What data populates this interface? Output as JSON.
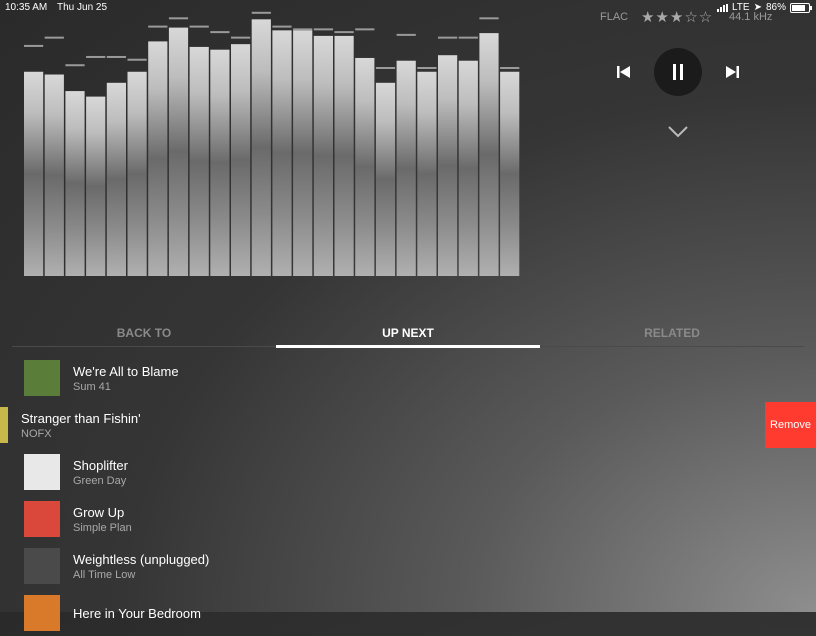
{
  "status": {
    "time": "10:35 AM",
    "date": "Thu Jun 25",
    "network": "LTE",
    "battery": "86%"
  },
  "now_playing": {
    "format": "FLAC",
    "rating_stars": "★★★☆☆",
    "rating": 3,
    "sample_rate": "44.1 kHz"
  },
  "controls": {
    "previous_icon": "skip-back-icon",
    "pause_icon": "pause-icon",
    "next_icon": "skip-forward-icon",
    "collapse_icon": "chevron-down-icon"
  },
  "tabs": [
    {
      "label": "BACK TO",
      "active": false
    },
    {
      "label": "UP NEXT",
      "active": true
    },
    {
      "label": "RELATED",
      "active": false
    }
  ],
  "queue": [
    {
      "title": "We're All to Blame",
      "artist": "Sum 41",
      "thumb_color": "#5a7d3a"
    },
    {
      "title": "Stranger than Fishin'",
      "artist": "NOFX",
      "thumb_color": "#c8b84a"
    },
    {
      "title": "Shoplifter",
      "artist": "Green Day",
      "thumb_color": "#e8e8e8"
    },
    {
      "title": "Grow Up",
      "artist": "Simple Plan",
      "thumb_color": "#d9483b"
    },
    {
      "title": "Weightless (unplugged)",
      "artist": "All Time Low",
      "thumb_color": "#4a4a4a"
    },
    {
      "title": "Here in Your Bedroom",
      "artist": "",
      "thumb_color": "#d97a2a"
    }
  ],
  "swipe_action": {
    "label": "Remove",
    "color": "#ff3b30"
  },
  "visualizer": {
    "levels": [
      0.74,
      0.73,
      0.67,
      0.65,
      0.7,
      0.74,
      0.85,
      0.9,
      0.83,
      0.82,
      0.84,
      0.93,
      0.89,
      0.89,
      0.87,
      0.87,
      0.79,
      0.7,
      0.78,
      0.74,
      0.8,
      0.78,
      0.88,
      0.74
    ],
    "peaks": [
      0.83,
      0.86,
      0.76,
      0.79,
      0.79,
      0.78,
      0.9,
      0.93,
      0.9,
      0.88,
      0.86,
      0.95,
      0.9,
      0.89,
      0.89,
      0.88,
      0.89,
      0.75,
      0.87,
      0.75,
      0.86,
      0.86,
      0.93,
      0.75
    ]
  }
}
